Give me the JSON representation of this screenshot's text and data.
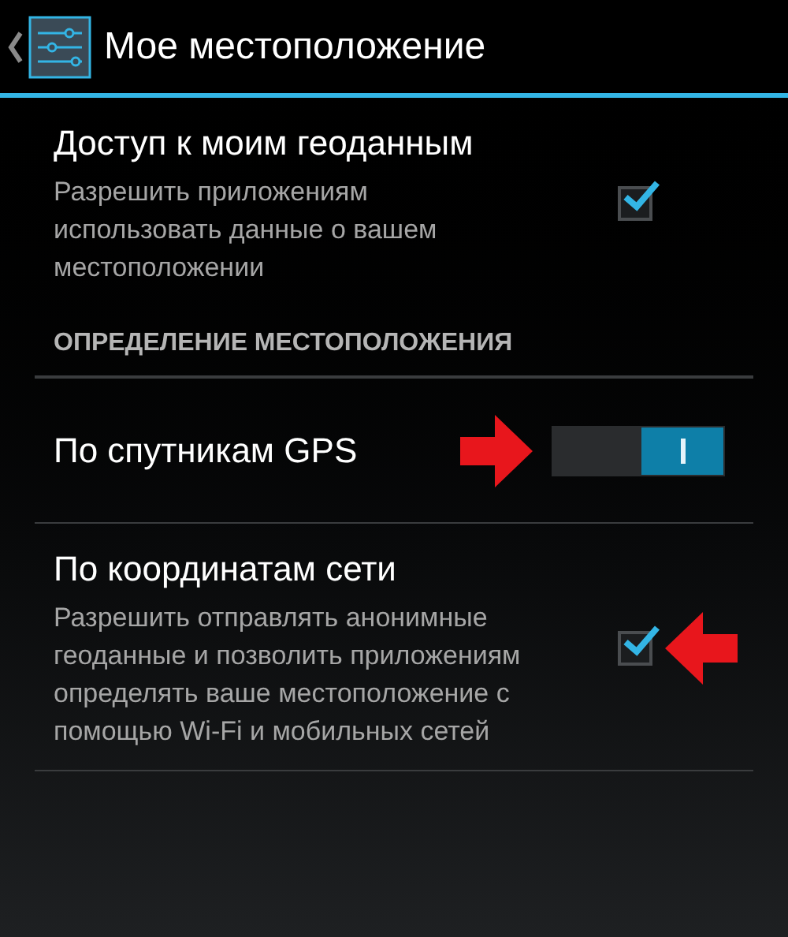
{
  "action_bar": {
    "title": "Мое местоположение"
  },
  "items": [
    {
      "kind": "checkbox",
      "title": "Доступ к моим геоданным",
      "summary_lines": [
        "Разрешить приложениям",
        "использовать данные о вашем",
        "местоположении"
      ],
      "checked": true,
      "arrow": false
    },
    {
      "kind": "header",
      "title": "ОПРЕДЕЛЕНИЕ МЕСТОПОЛОЖЕНИЯ"
    },
    {
      "kind": "switch",
      "title": "По спутникам GPS",
      "on": true,
      "arrow": true
    },
    {
      "kind": "checkbox",
      "title": "По координатам сети",
      "summary_lines": [
        "Разрешить отправлять анонимные",
        "геоданные и позволить приложениям",
        "определять ваше местоположение с",
        "помощью Wi-Fi и мобильных сетей"
      ],
      "checked": true,
      "arrow": true
    }
  ]
}
